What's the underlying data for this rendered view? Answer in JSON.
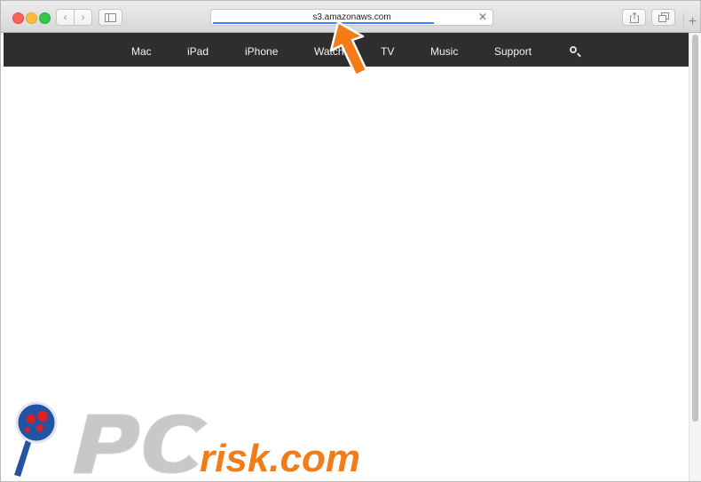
{
  "browser": {
    "address": "s3.amazonaws.com",
    "icons": {
      "back": "chevron-left-icon",
      "forward": "chevron-right-icon",
      "sidebar": "sidebar-icon",
      "clear": "close-icon",
      "share": "share-icon",
      "tabs": "tabs-icon",
      "new_tab": "plus-icon"
    },
    "progress_percent": 78
  },
  "site_nav": {
    "items": [
      "Mac",
      "iPad",
      "iPhone",
      "Watch",
      "TV",
      "Music",
      "Support"
    ]
  },
  "watermark": {
    "text": "PCrisk.com"
  },
  "colors": {
    "nav_bg": "#2e2e2e",
    "arrow": "#f27c18",
    "progress": "#3a82f7"
  }
}
